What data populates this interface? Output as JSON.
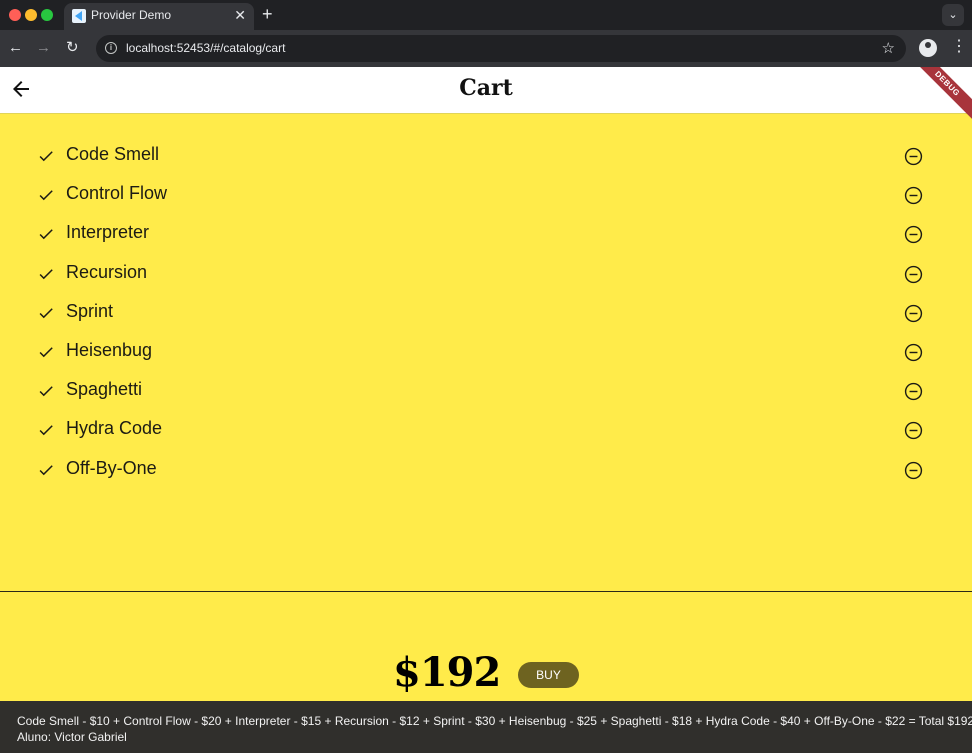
{
  "browser": {
    "tab_title": "Provider Demo",
    "tab_close": "✕",
    "new_tab": "+",
    "tab_menu": "⌄",
    "url": "localhost:52453/#/catalog/cart"
  },
  "app": {
    "title": "Cart",
    "debug_banner": "DEBUG",
    "items": [
      {
        "name": "Code Smell"
      },
      {
        "name": "Control Flow"
      },
      {
        "name": "Interpreter"
      },
      {
        "name": "Recursion"
      },
      {
        "name": "Sprint"
      },
      {
        "name": "Heisenbug"
      },
      {
        "name": "Spaghetti"
      },
      {
        "name": "Hydra Code"
      },
      {
        "name": "Off-By-One"
      }
    ],
    "total": "$192",
    "buy_label": "BUY"
  },
  "footer": {
    "summary": "Code Smell - $10 + Control Flow - $20 + Interpreter - $15 + Recursion - $12 + Sprint - $30 + Heisenbug - $25 + Spaghetti - $18 + Hydra Code - $40 + Off-By-One - $22  = Total $192",
    "author": "Aluno: Victor Gabriel"
  },
  "colors": {
    "background": "#ffeb4a",
    "buy_button": "#6e6320",
    "footer": "#302f2c"
  }
}
